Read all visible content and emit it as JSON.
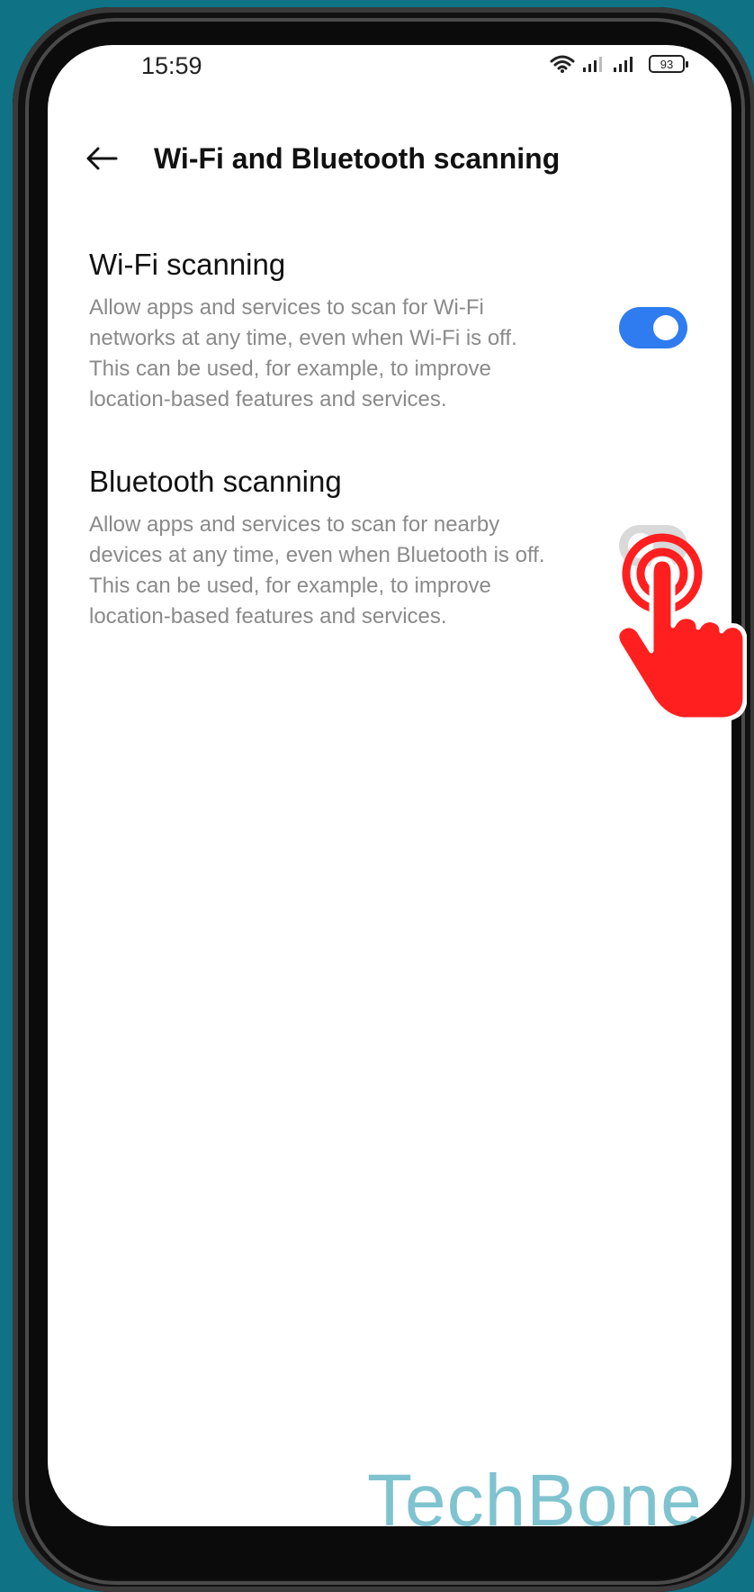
{
  "status_bar": {
    "time": "15:59",
    "battery": "93",
    "icons": [
      "wifi-icon",
      "signal-icon",
      "signal-icon",
      "battery-icon"
    ]
  },
  "header": {
    "back_icon": "arrow-left-icon",
    "title": "Wi-Fi and Bluetooth scanning"
  },
  "settings": [
    {
      "title": "Wi-Fi scanning",
      "description": "Allow apps and services to scan for Wi-Fi networks at any time, even when Wi-Fi is off. This can be used, for example, to improve location-based features and services.",
      "enabled": true
    },
    {
      "title": "Bluetooth scanning",
      "description": "Allow apps and services to scan for nearby devices at any time, even when Bluetooth is off. This can be used, for example, to improve location-based features and services.",
      "enabled": false
    }
  ],
  "watermark": "TechBone",
  "colors": {
    "accent": "#2f7bf0",
    "background": "#0f7285",
    "tap_indicator": "#ff1f1f",
    "watermark": "#7fc3d0"
  }
}
